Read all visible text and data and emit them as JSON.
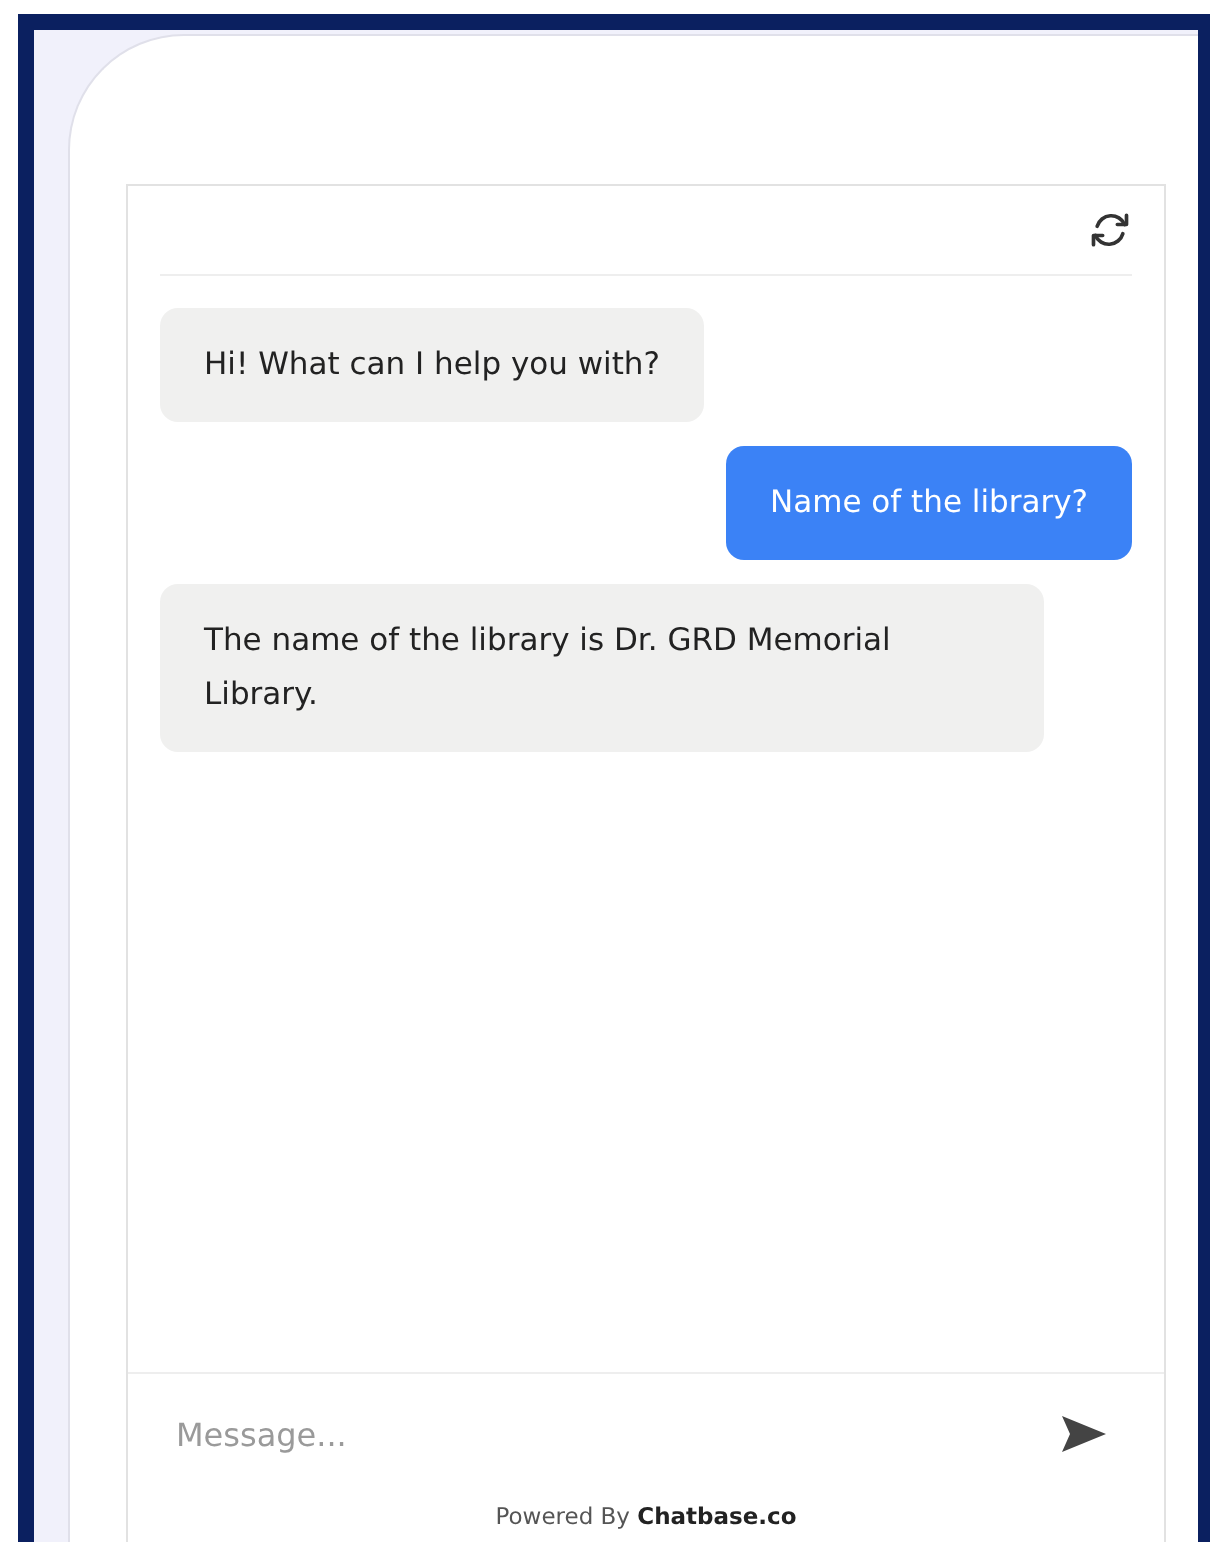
{
  "messages": [
    {
      "kind": "bot",
      "text": "Hi! What can I help you with?"
    },
    {
      "kind": "user",
      "text": "Name of the library?"
    },
    {
      "kind": "bot",
      "text": "The name of the library is Dr. GRD Memorial Library."
    }
  ],
  "composer": {
    "placeholder": "Message..."
  },
  "footer": "Powered By **Chatbase.co**"
}
